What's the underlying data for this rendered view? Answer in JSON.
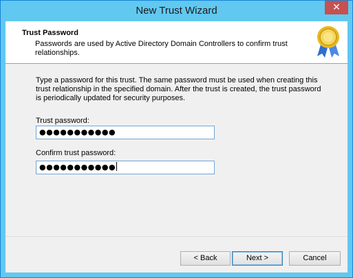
{
  "window": {
    "title": "New Trust Wizard",
    "close_glyph": "✕"
  },
  "header": {
    "title": "Trust Password",
    "subtitle": "Passwords are used by Active Directory Domain Controllers to confirm trust relationships."
  },
  "intro": "Type a password for this trust. The same password must be used when creating this trust relationship in the specified domain. After the trust is created, the trust password is periodically updated for security purposes.",
  "fields": {
    "trust_password": {
      "label": "Trust password:",
      "value": "●●●●●●●●●●●"
    },
    "confirm_password": {
      "label": "Confirm trust password:",
      "value": "●●●●●●●●●●●"
    }
  },
  "buttons": {
    "back": "< Back",
    "next": "Next >",
    "cancel": "Cancel"
  },
  "colors": {
    "titlebar": "#61c8f0",
    "close": "#c75050",
    "field_border": "#6fa5d8"
  },
  "icons": {
    "seal": "certificate-seal-icon",
    "close": "close-icon"
  }
}
